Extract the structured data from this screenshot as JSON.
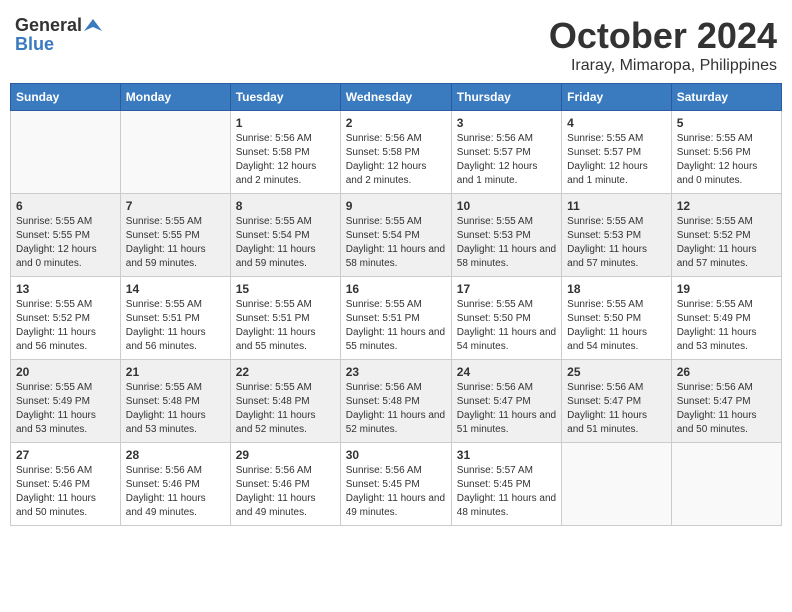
{
  "logo": {
    "line1": "General",
    "line2": "Blue"
  },
  "title": "October 2024",
  "subtitle": "Iraray, Mimaropa, Philippines",
  "weekdays": [
    "Sunday",
    "Monday",
    "Tuesday",
    "Wednesday",
    "Thursday",
    "Friday",
    "Saturday"
  ],
  "weeks": [
    [
      {
        "day": "",
        "sunrise": "",
        "sunset": "",
        "daylight": ""
      },
      {
        "day": "",
        "sunrise": "",
        "sunset": "",
        "daylight": ""
      },
      {
        "day": "1",
        "sunrise": "Sunrise: 5:56 AM",
        "sunset": "Sunset: 5:58 PM",
        "daylight": "Daylight: 12 hours and 2 minutes."
      },
      {
        "day": "2",
        "sunrise": "Sunrise: 5:56 AM",
        "sunset": "Sunset: 5:58 PM",
        "daylight": "Daylight: 12 hours and 2 minutes."
      },
      {
        "day": "3",
        "sunrise": "Sunrise: 5:56 AM",
        "sunset": "Sunset: 5:57 PM",
        "daylight": "Daylight: 12 hours and 1 minute."
      },
      {
        "day": "4",
        "sunrise": "Sunrise: 5:55 AM",
        "sunset": "Sunset: 5:57 PM",
        "daylight": "Daylight: 12 hours and 1 minute."
      },
      {
        "day": "5",
        "sunrise": "Sunrise: 5:55 AM",
        "sunset": "Sunset: 5:56 PM",
        "daylight": "Daylight: 12 hours and 0 minutes."
      }
    ],
    [
      {
        "day": "6",
        "sunrise": "Sunrise: 5:55 AM",
        "sunset": "Sunset: 5:55 PM",
        "daylight": "Daylight: 12 hours and 0 minutes."
      },
      {
        "day": "7",
        "sunrise": "Sunrise: 5:55 AM",
        "sunset": "Sunset: 5:55 PM",
        "daylight": "Daylight: 11 hours and 59 minutes."
      },
      {
        "day": "8",
        "sunrise": "Sunrise: 5:55 AM",
        "sunset": "Sunset: 5:54 PM",
        "daylight": "Daylight: 11 hours and 59 minutes."
      },
      {
        "day": "9",
        "sunrise": "Sunrise: 5:55 AM",
        "sunset": "Sunset: 5:54 PM",
        "daylight": "Daylight: 11 hours and 58 minutes."
      },
      {
        "day": "10",
        "sunrise": "Sunrise: 5:55 AM",
        "sunset": "Sunset: 5:53 PM",
        "daylight": "Daylight: 11 hours and 58 minutes."
      },
      {
        "day": "11",
        "sunrise": "Sunrise: 5:55 AM",
        "sunset": "Sunset: 5:53 PM",
        "daylight": "Daylight: 11 hours and 57 minutes."
      },
      {
        "day": "12",
        "sunrise": "Sunrise: 5:55 AM",
        "sunset": "Sunset: 5:52 PM",
        "daylight": "Daylight: 11 hours and 57 minutes."
      }
    ],
    [
      {
        "day": "13",
        "sunrise": "Sunrise: 5:55 AM",
        "sunset": "Sunset: 5:52 PM",
        "daylight": "Daylight: 11 hours and 56 minutes."
      },
      {
        "day": "14",
        "sunrise": "Sunrise: 5:55 AM",
        "sunset": "Sunset: 5:51 PM",
        "daylight": "Daylight: 11 hours and 56 minutes."
      },
      {
        "day": "15",
        "sunrise": "Sunrise: 5:55 AM",
        "sunset": "Sunset: 5:51 PM",
        "daylight": "Daylight: 11 hours and 55 minutes."
      },
      {
        "day": "16",
        "sunrise": "Sunrise: 5:55 AM",
        "sunset": "Sunset: 5:51 PM",
        "daylight": "Daylight: 11 hours and 55 minutes."
      },
      {
        "day": "17",
        "sunrise": "Sunrise: 5:55 AM",
        "sunset": "Sunset: 5:50 PM",
        "daylight": "Daylight: 11 hours and 54 minutes."
      },
      {
        "day": "18",
        "sunrise": "Sunrise: 5:55 AM",
        "sunset": "Sunset: 5:50 PM",
        "daylight": "Daylight: 11 hours and 54 minutes."
      },
      {
        "day": "19",
        "sunrise": "Sunrise: 5:55 AM",
        "sunset": "Sunset: 5:49 PM",
        "daylight": "Daylight: 11 hours and 53 minutes."
      }
    ],
    [
      {
        "day": "20",
        "sunrise": "Sunrise: 5:55 AM",
        "sunset": "Sunset: 5:49 PM",
        "daylight": "Daylight: 11 hours and 53 minutes."
      },
      {
        "day": "21",
        "sunrise": "Sunrise: 5:55 AM",
        "sunset": "Sunset: 5:48 PM",
        "daylight": "Daylight: 11 hours and 53 minutes."
      },
      {
        "day": "22",
        "sunrise": "Sunrise: 5:55 AM",
        "sunset": "Sunset: 5:48 PM",
        "daylight": "Daylight: 11 hours and 52 minutes."
      },
      {
        "day": "23",
        "sunrise": "Sunrise: 5:56 AM",
        "sunset": "Sunset: 5:48 PM",
        "daylight": "Daylight: 11 hours and 52 minutes."
      },
      {
        "day": "24",
        "sunrise": "Sunrise: 5:56 AM",
        "sunset": "Sunset: 5:47 PM",
        "daylight": "Daylight: 11 hours and 51 minutes."
      },
      {
        "day": "25",
        "sunrise": "Sunrise: 5:56 AM",
        "sunset": "Sunset: 5:47 PM",
        "daylight": "Daylight: 11 hours and 51 minutes."
      },
      {
        "day": "26",
        "sunrise": "Sunrise: 5:56 AM",
        "sunset": "Sunset: 5:47 PM",
        "daylight": "Daylight: 11 hours and 50 minutes."
      }
    ],
    [
      {
        "day": "27",
        "sunrise": "Sunrise: 5:56 AM",
        "sunset": "Sunset: 5:46 PM",
        "daylight": "Daylight: 11 hours and 50 minutes."
      },
      {
        "day": "28",
        "sunrise": "Sunrise: 5:56 AM",
        "sunset": "Sunset: 5:46 PM",
        "daylight": "Daylight: 11 hours and 49 minutes."
      },
      {
        "day": "29",
        "sunrise": "Sunrise: 5:56 AM",
        "sunset": "Sunset: 5:46 PM",
        "daylight": "Daylight: 11 hours and 49 minutes."
      },
      {
        "day": "30",
        "sunrise": "Sunrise: 5:56 AM",
        "sunset": "Sunset: 5:45 PM",
        "daylight": "Daylight: 11 hours and 49 minutes."
      },
      {
        "day": "31",
        "sunrise": "Sunrise: 5:57 AM",
        "sunset": "Sunset: 5:45 PM",
        "daylight": "Daylight: 11 hours and 48 minutes."
      },
      {
        "day": "",
        "sunrise": "",
        "sunset": "",
        "daylight": ""
      },
      {
        "day": "",
        "sunrise": "",
        "sunset": "",
        "daylight": ""
      }
    ]
  ]
}
